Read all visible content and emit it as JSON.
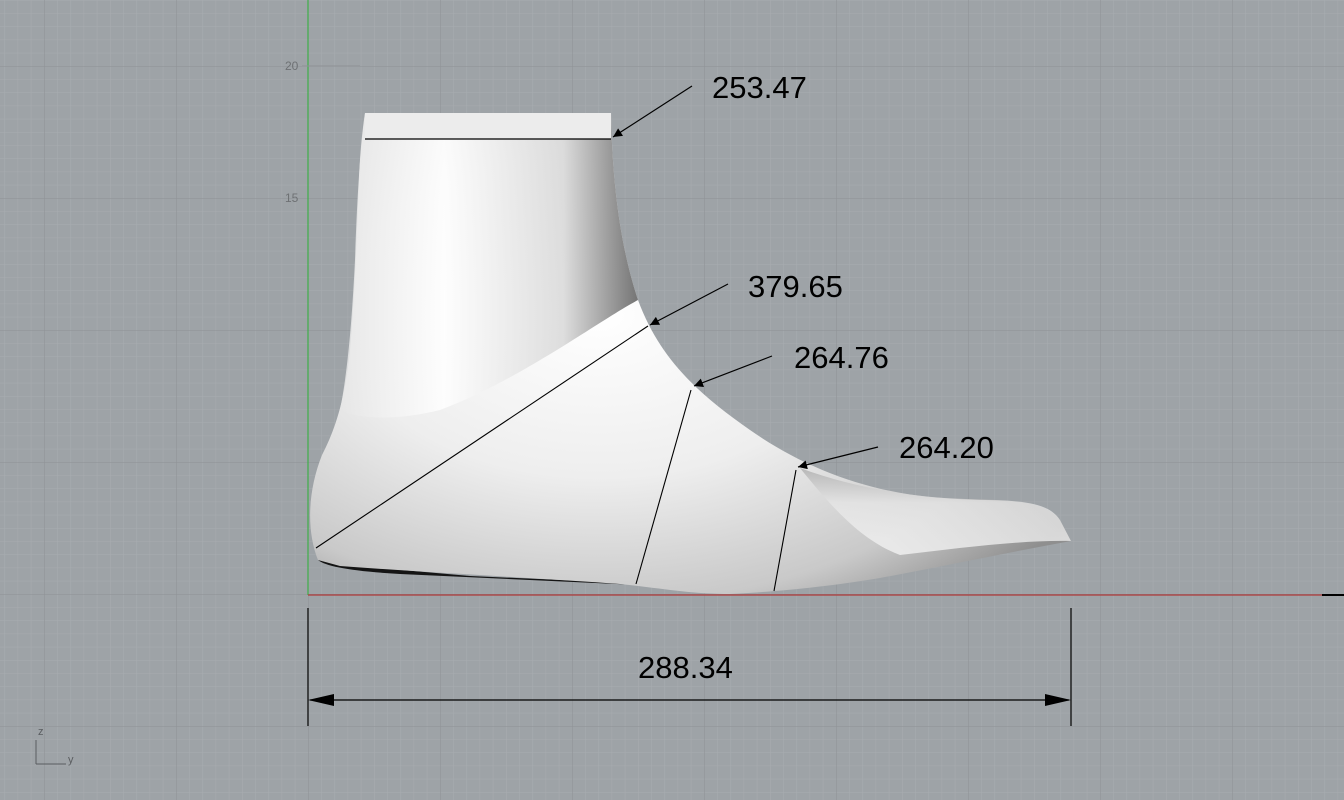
{
  "viewport": {
    "name": "right-view",
    "axis_ticks": {
      "y20": "20",
      "y15": "15"
    },
    "triad": {
      "z": "z",
      "y": "y"
    },
    "colors": {
      "background": "#9ea3a7",
      "grid_minor": "#a6aaae",
      "grid_major": "#8b8f93",
      "x_axis": "#b03a3a",
      "z_axis": "#3fae49",
      "dimension": "#000000"
    }
  },
  "model": {
    "name": "shoe-last"
  },
  "dimensions": {
    "top_girth": "253.47",
    "instep_girth": "379.65",
    "waist_girth": "264.76",
    "ball_girth": "264.20",
    "length": "288.34"
  }
}
